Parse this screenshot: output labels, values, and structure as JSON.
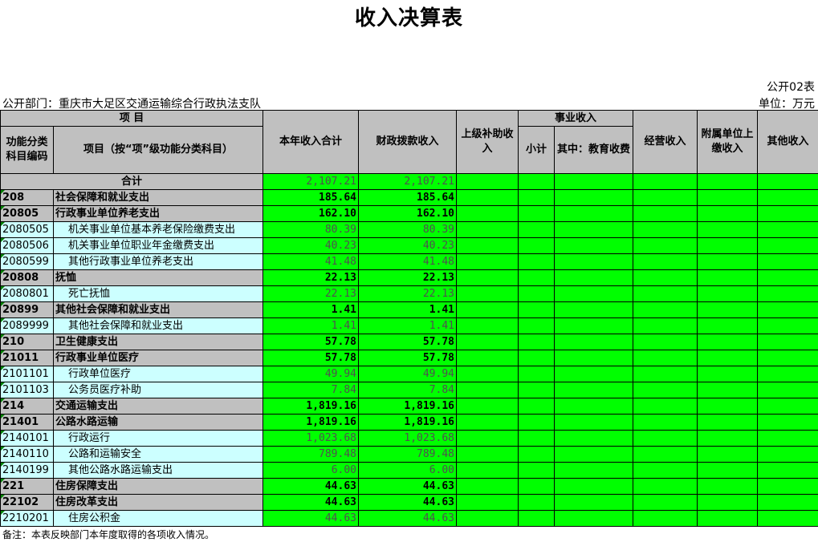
{
  "title": "收入决算表",
  "form_no": "公开02表",
  "department": "公开部门：重庆市大足区交通运输综合行政执法支队",
  "unit": "单位：万元",
  "headers": {
    "item": "项          目",
    "code": "功能分类科目编码",
    "name": "项目（按“项”级功能分类科目）",
    "total_income": "本年收入合计",
    "fiscal": "财政拨款收入",
    "superior_subsidy": "上级补助收入",
    "business_income": "事业收入",
    "subtotal": "小计",
    "education_fee": "其中：教育收费",
    "operating": "经营收入",
    "affiliated": "附属单位上缴收入",
    "other": "其他收入"
  },
  "total_row": {
    "label": "合计",
    "total": "2,107.21",
    "fiscal": "2,107.21"
  },
  "rows": [
    {
      "code": "208",
      "name": "社会保障和就业支出",
      "total": "185.64",
      "fiscal": "185.64",
      "level": "grey"
    },
    {
      "code": "20805",
      "name": "行政事业单位养老支出",
      "total": "162.10",
      "fiscal": "162.10",
      "level": "grey"
    },
    {
      "code": "2080505",
      "name": "机关事业单位基本养老保险缴费支出",
      "total": "80.39",
      "fiscal": "80.39",
      "level": "leaf"
    },
    {
      "code": "2080506",
      "name": "机关事业单位职业年金缴费支出",
      "total": "40.23",
      "fiscal": "40.23",
      "level": "leaf"
    },
    {
      "code": "2080599",
      "name": "其他行政事业单位养老支出",
      "total": "41.48",
      "fiscal": "41.48",
      "level": "leaf"
    },
    {
      "code": "20808",
      "name": "抚恤",
      "total": "22.13",
      "fiscal": "22.13",
      "level": "grey"
    },
    {
      "code": "2080801",
      "name": "死亡抚恤",
      "total": "22.13",
      "fiscal": "22.13",
      "level": "leaf"
    },
    {
      "code": "20899",
      "name": "其他社会保障和就业支出",
      "total": "1.41",
      "fiscal": "1.41",
      "level": "grey"
    },
    {
      "code": "2089999",
      "name": "其他社会保障和就业支出",
      "total": "1.41",
      "fiscal": "1.41",
      "level": "leaf"
    },
    {
      "code": "210",
      "name": "卫生健康支出",
      "total": "57.78",
      "fiscal": "57.78",
      "level": "grey"
    },
    {
      "code": "21011",
      "name": "行政事业单位医疗",
      "total": "57.78",
      "fiscal": "57.78",
      "level": "grey"
    },
    {
      "code": "2101101",
      "name": "行政单位医疗",
      "total": "49.94",
      "fiscal": "49.94",
      "level": "leaf"
    },
    {
      "code": "2101103",
      "name": "公务员医疗补助",
      "total": "7.84",
      "fiscal": "7.84",
      "level": "leaf"
    },
    {
      "code": "214",
      "name": "交通运输支出",
      "total": "1,819.16",
      "fiscal": "1,819.16",
      "level": "grey"
    },
    {
      "code": "21401",
      "name": "公路水路运输",
      "total": "1,819.16",
      "fiscal": "1,819.16",
      "level": "grey"
    },
    {
      "code": "2140101",
      "name": "行政运行",
      "total": "1,023.68",
      "fiscal": "1,023.68",
      "level": "leaf"
    },
    {
      "code": "2140110",
      "name": "公路和运输安全",
      "total": "789.48",
      "fiscal": "789.48",
      "level": "leaf"
    },
    {
      "code": "2140199",
      "name": "其他公路水路运输支出",
      "total": "6.00",
      "fiscal": "6.00",
      "level": "leaf"
    },
    {
      "code": "221",
      "name": "住房保障支出",
      "total": "44.63",
      "fiscal": "44.63",
      "level": "grey"
    },
    {
      "code": "22102",
      "name": "住房改革支出",
      "total": "44.63",
      "fiscal": "44.63",
      "level": "grey"
    },
    {
      "code": "2210201",
      "name": "住房公积金",
      "total": "44.63",
      "fiscal": "44.63",
      "level": "leaf"
    }
  ],
  "note": "备注：本表反映部门本年度取得的各项收入情况。"
}
